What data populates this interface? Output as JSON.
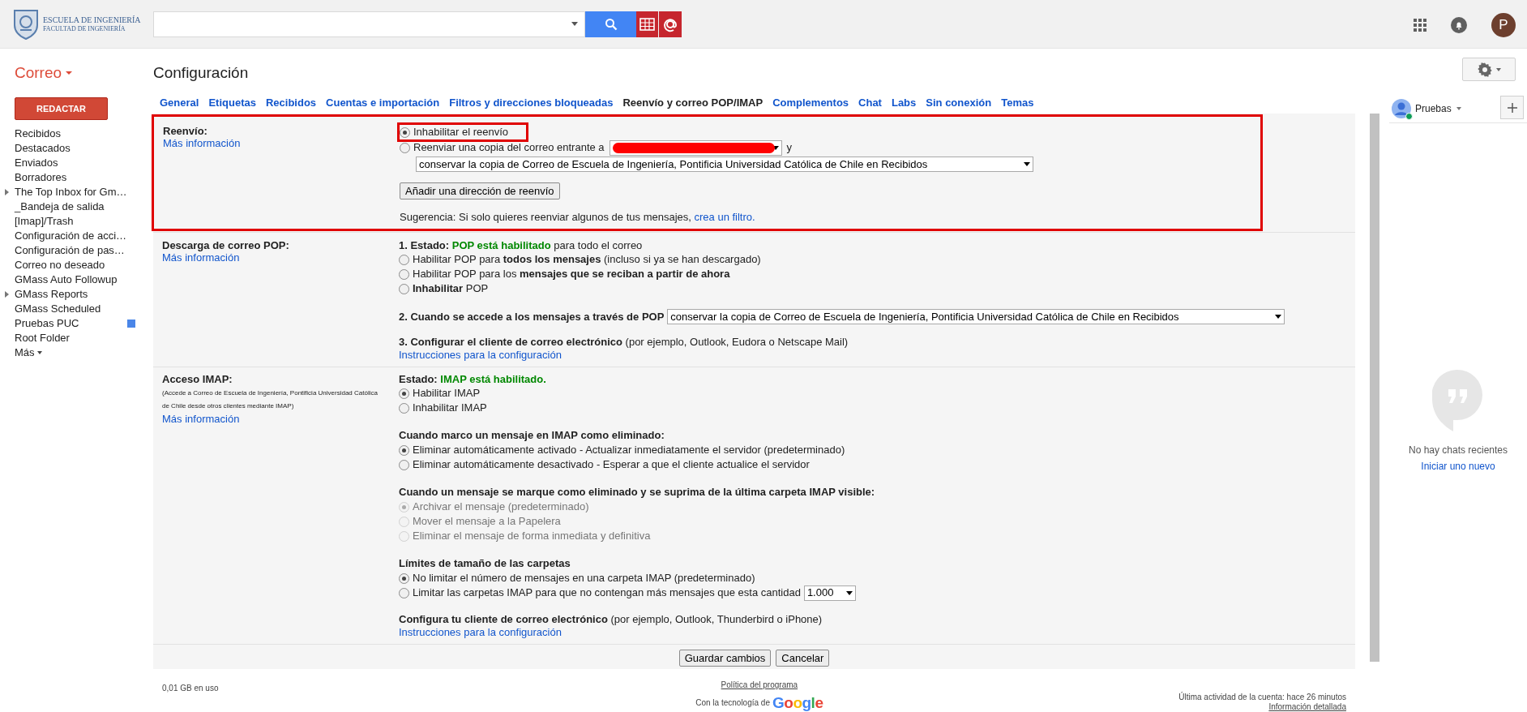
{
  "logo": {
    "title": "ESCUELA DE INGENIERÍA",
    "subtitle": "FACULTAD DE INGENIERÍA"
  },
  "account": {
    "avatar_letter": "P"
  },
  "app_switch": {
    "label": "Correo"
  },
  "page_title": "Configuración",
  "compose_button": "REDACTAR",
  "sidebar": {
    "items": [
      {
        "label": "Recibidos",
        "expandable": false
      },
      {
        "label": "Destacados",
        "expandable": false
      },
      {
        "label": "Enviados",
        "expandable": false
      },
      {
        "label": "Borradores",
        "expandable": false
      },
      {
        "label": "The Top Inbox for Gm…",
        "expandable": true
      },
      {
        "label": "_Bandeja de salida",
        "expandable": false
      },
      {
        "label": "[Imap]/Trash",
        "expandable": false
      },
      {
        "label": "Configuración de acci…",
        "expandable": false
      },
      {
        "label": "Configuración de pas…",
        "expandable": false
      },
      {
        "label": "Correo no deseado",
        "expandable": false
      },
      {
        "label": "GMass Auto Followup",
        "expandable": false
      },
      {
        "label": "GMass Reports",
        "expandable": true
      },
      {
        "label": "GMass Scheduled",
        "expandable": false
      },
      {
        "label": "Pruebas PUC",
        "expandable": false,
        "color": "#4a86e8"
      },
      {
        "label": "Root Folder",
        "expandable": false
      }
    ],
    "more": "Más"
  },
  "tabs": [
    {
      "label": "General",
      "selected": false
    },
    {
      "label": "Etiquetas",
      "selected": false
    },
    {
      "label": "Recibidos",
      "selected": false
    },
    {
      "label": "Cuentas e importación",
      "selected": false
    },
    {
      "label": "Filtros y direcciones bloqueadas",
      "selected": false
    },
    {
      "label": "Reenvío y correo POP/IMAP",
      "selected": true
    },
    {
      "label": "Complementos",
      "selected": false
    },
    {
      "label": "Chat",
      "selected": false
    },
    {
      "label": "Labs",
      "selected": false
    },
    {
      "label": "Sin conexión",
      "selected": false
    },
    {
      "label": "Temas",
      "selected": false
    }
  ],
  "forwarding": {
    "label": "Reenvío:",
    "link": "Más información",
    "highlighted": true,
    "options": [
      {
        "label": "Inhabilitar el reenvío",
        "selected": true,
        "highlighted": true
      },
      {
        "label": "Reenviar una copia del correo entrante a",
        "selected": false,
        "highlighted": false,
        "after": "y"
      }
    ],
    "keep_select": "conservar la copia de Correo de Escuela de Ingeniería, Pontificia Universidad Católica de Chile en Recibidos",
    "add_button": "Añadir una dirección de reenvío",
    "hint": "Sugerencia: Si solo quieres reenviar algunos de tus mensajes,",
    "hint_link": "crea un filtro."
  },
  "pop_download": {
    "label": "Descarga de correo POP:",
    "link": "Más información",
    "status": {
      "label": "1. Estado:",
      "value": "POP está habilitado",
      "rest": "para todo el correo"
    },
    "options": [
      {
        "label": "Habilitar POP para **todos los mensajes** (incluso si ya se han descargado)",
        "selected": false
      },
      {
        "label": "Habilitar POP para los **mensajes que se reciban a partir de ahora**",
        "selected": false
      },
      {
        "label": "**Inhabilitar** POP",
        "selected": false
      }
    ],
    "access_label": "2. Cuando se accede a los mensajes a través de POP",
    "access_select": "conservar la copia de Correo de Escuela de Ingeniería, Pontificia Universidad Católica de Chile en Recibidos",
    "client_text": "**3. Configurar el cliente de correo electrónico** (por ejemplo, Outlook, Eudora o Netscape Mail)",
    "client_link": "Instrucciones para la configuración"
  },
  "imap_access": {
    "label": "Acceso IMAP:",
    "note": "(Accede a Correo de Escuela de Ingeniería, Pontificia Universidad Católica de Chile desde otros clientes mediante IMAP)",
    "link": "Más información",
    "status": {
      "label": "Estado:",
      "value": "IMAP está habilitado."
    },
    "groups": [
      {
        "options": [
          {
            "label": "Habilitar IMAP",
            "selected": true,
            "disabled": false
          },
          {
            "label": "Inhabilitar IMAP",
            "selected": false,
            "disabled": false
          }
        ]
      },
      {
        "heading": "Cuando marco un mensaje en IMAP como eliminado:",
        "options": [
          {
            "label": "Eliminar automáticamente activado - Actualizar inmediatamente el servidor (predeterminado)",
            "selected": true,
            "disabled": false
          },
          {
            "label": "Eliminar automáticamente desactivado - Esperar a que el cliente actualice el servidor",
            "selected": false,
            "disabled": false
          }
        ]
      },
      {
        "heading": "Cuando un mensaje se marque como eliminado y se suprima de la última carpeta IMAP visible:",
        "options": [
          {
            "label": "Archivar el mensaje (predeterminado)",
            "selected": true,
            "disabled": true
          },
          {
            "label": "Mover el mensaje a la Papelera",
            "selected": false,
            "disabled": true
          },
          {
            "label": "Eliminar el mensaje de forma inmediata y definitiva",
            "selected": false,
            "disabled": true
          }
        ]
      },
      {
        "heading": "Límites de tamaño de las carpetas",
        "options": [
          {
            "label": "No limitar el número de mensajes en una carpeta IMAP (predeterminado)",
            "selected": true,
            "disabled": false
          },
          {
            "label": "Limitar las carpetas IMAP para que no contengan más mensajes que esta cantidad",
            "selected": false,
            "disabled": false,
            "select": "1.000"
          }
        ]
      }
    ],
    "client_text": "**Configura tu cliente de correo electrónico** (por ejemplo, Outlook, Thunderbird o iPhone)",
    "client_link": "Instrucciones para la configuración"
  },
  "buttons": [
    "Guardar cambios",
    "Cancelar"
  ],
  "footer": {
    "usage": "0,01 GB en uso",
    "policy_link": "Política del programa",
    "powered_by": "Con la tecnología de",
    "brand": "Google",
    "last_activity": "Última actividad de la cuenta: hace 26 minutos",
    "details_link": "Información detallada"
  },
  "chat": {
    "user": "Pruebas",
    "online": true,
    "empty_text": "No hay chats recientes",
    "start_link": "Iniciar uno nuevo"
  }
}
